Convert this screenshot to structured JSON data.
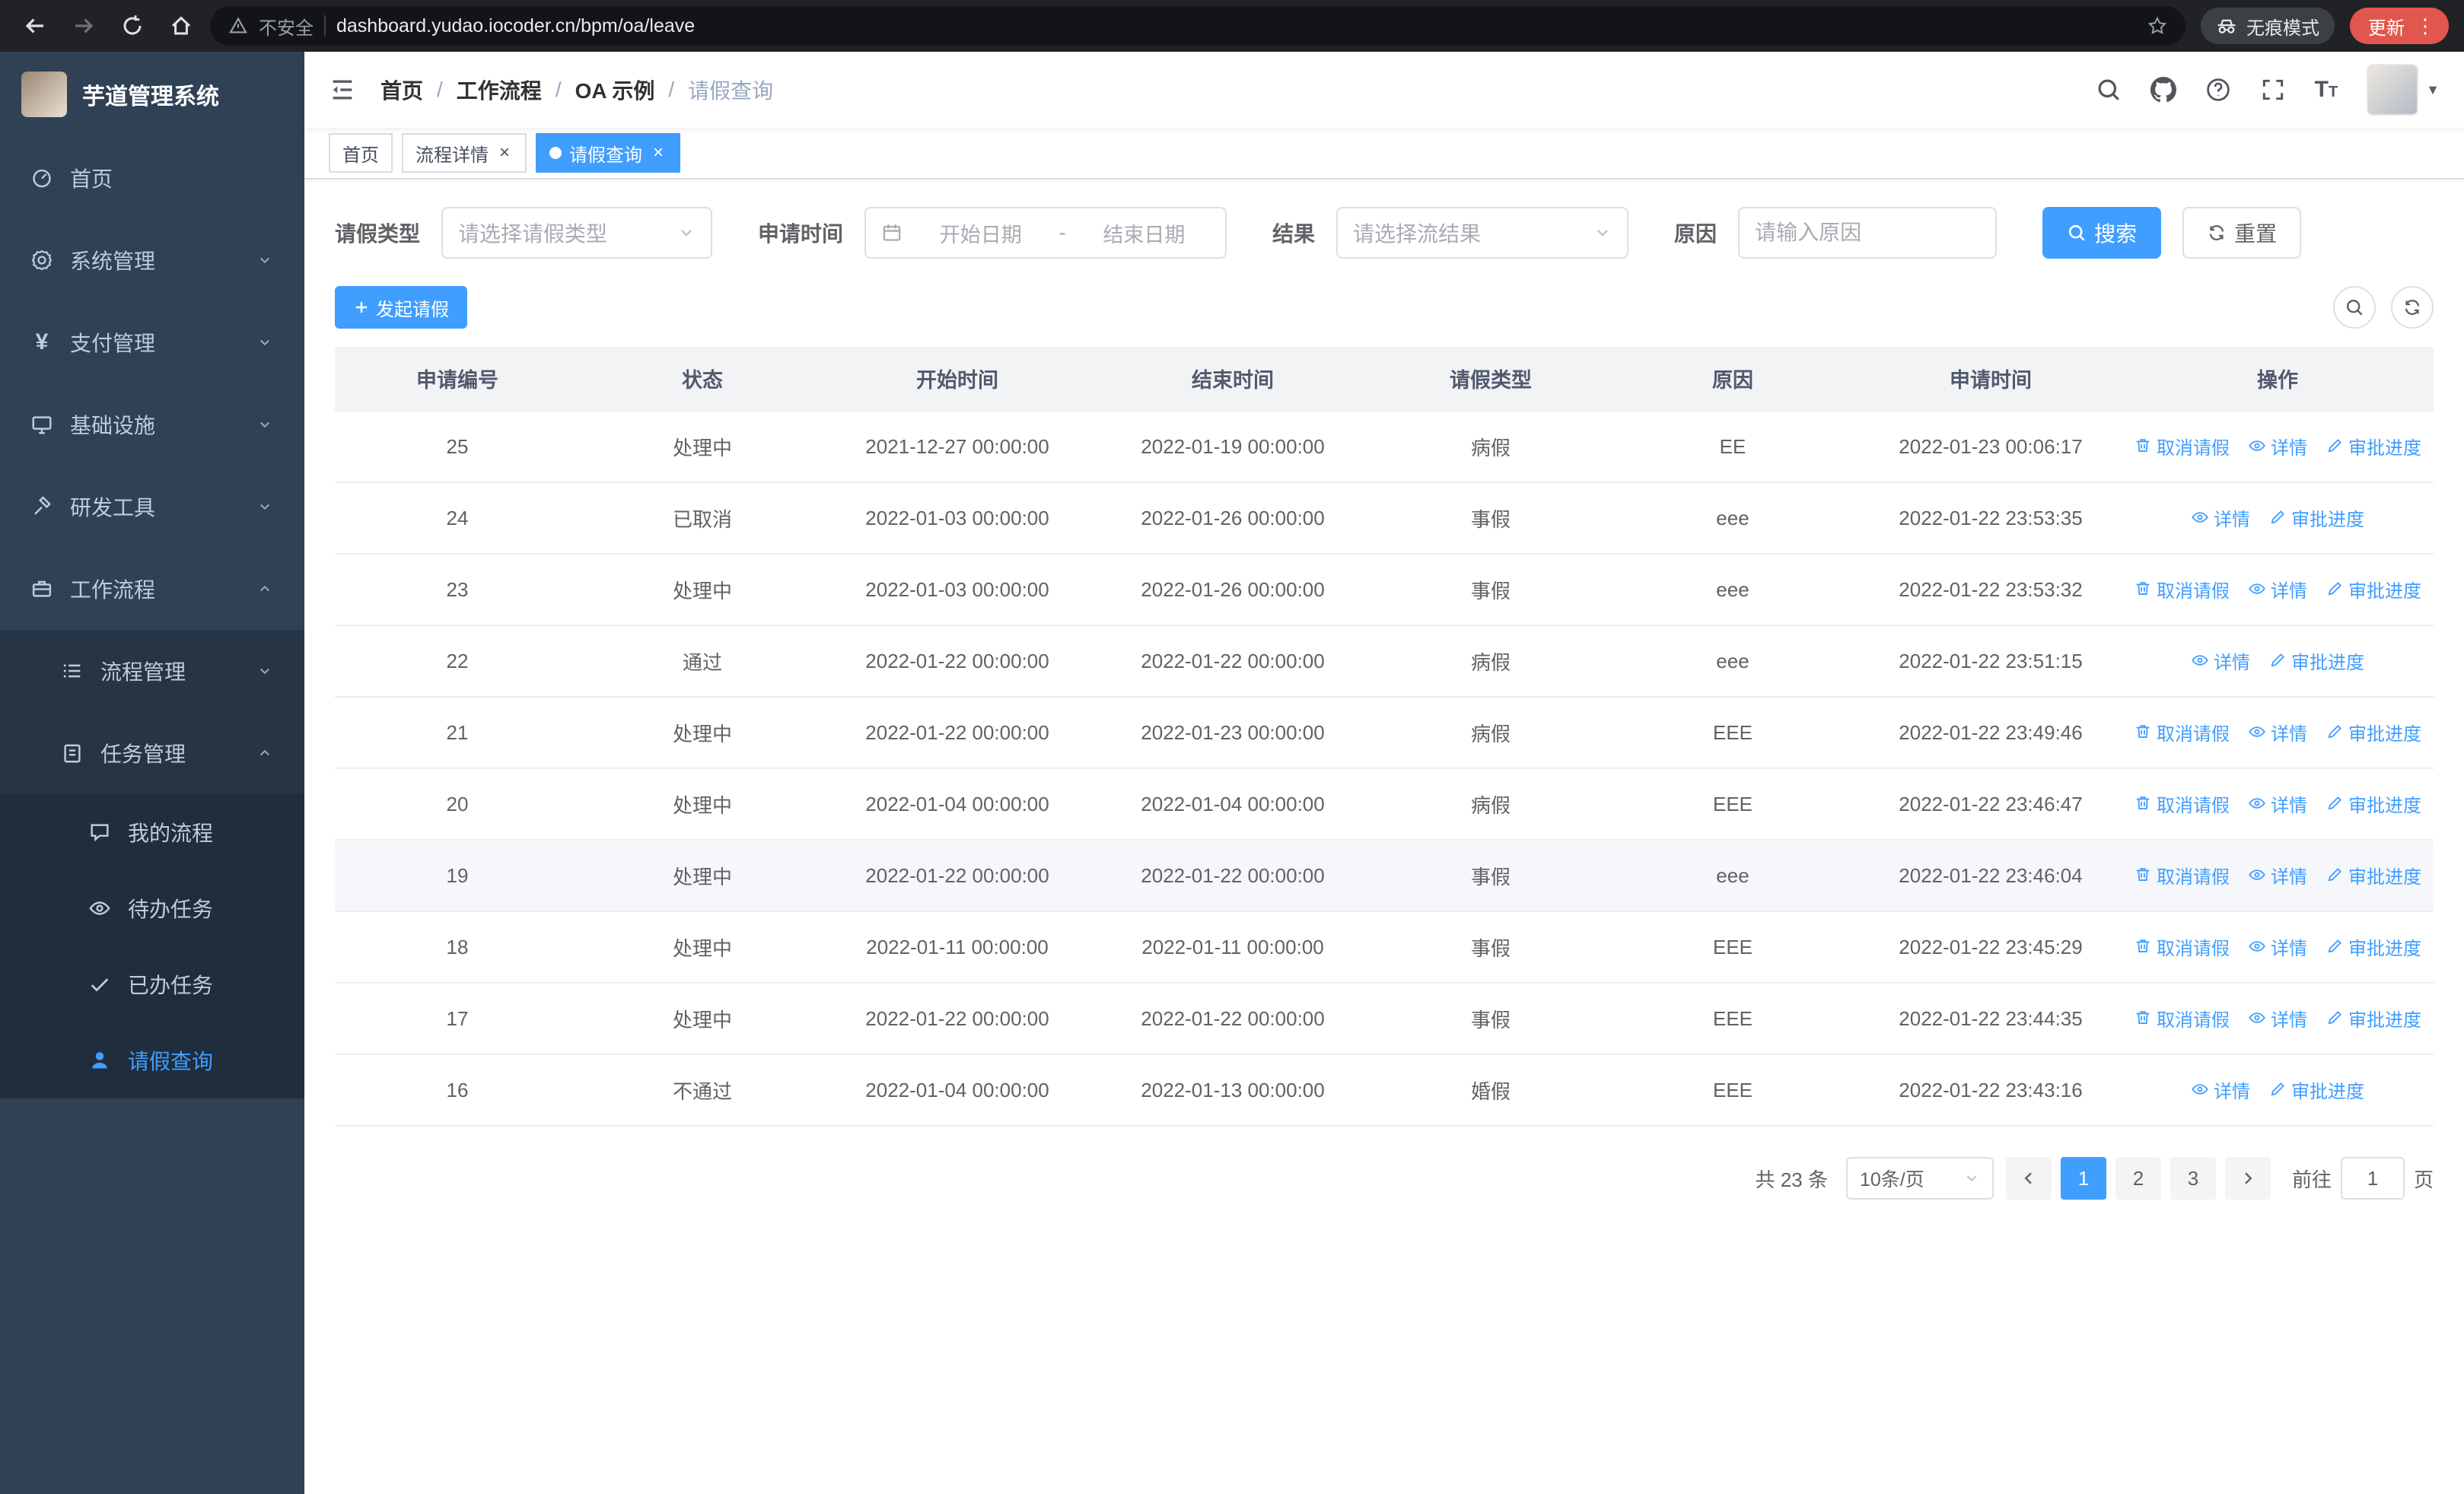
{
  "browser": {
    "security_label": "不安全",
    "url": "dashboard.yudao.iocoder.cn/bpm/oa/leave",
    "incognito_label": "无痕模式",
    "update_label": "更新"
  },
  "sidebar": {
    "title": "芋道管理系统",
    "items": [
      {
        "label": "首页"
      },
      {
        "label": "系统管理"
      },
      {
        "label": "支付管理"
      },
      {
        "label": "基础设施"
      },
      {
        "label": "研发工具"
      },
      {
        "label": "工作流程"
      }
    ],
    "workflow_children": [
      {
        "label": "流程管理"
      },
      {
        "label": "任务管理"
      }
    ],
    "task_children": [
      {
        "label": "我的流程"
      },
      {
        "label": "待办任务"
      },
      {
        "label": "已办任务"
      },
      {
        "label": "请假查询"
      }
    ]
  },
  "header": {
    "breadcrumb": [
      "首页",
      "工作流程",
      "OA 示例",
      "请假查询"
    ]
  },
  "tabs": [
    {
      "label": "首页"
    },
    {
      "label": "流程详情"
    },
    {
      "label": "请假查询"
    }
  ],
  "filters": {
    "leave_type_label": "请假类型",
    "leave_type_placeholder": "请选择请假类型",
    "apply_time_label": "申请时间",
    "start_placeholder": "开始日期",
    "range_separator": "-",
    "end_placeholder": "结束日期",
    "result_label": "结果",
    "result_placeholder": "请选择流结果",
    "reason_label": "原因",
    "reason_placeholder": "请输入原因",
    "search_label": "搜索",
    "reset_label": "重置"
  },
  "toolbar": {
    "create_label": "发起请假"
  },
  "table": {
    "headers": [
      "申请编号",
      "状态",
      "开始时间",
      "结束时间",
      "请假类型",
      "原因",
      "申请时间",
      "操作"
    ],
    "actions": {
      "cancel": {
        "label": "取消请假",
        "icon": "delete-icon"
      },
      "detail": {
        "label": "详情",
        "icon": "view-icon"
      },
      "progress": {
        "label": "审批进度",
        "icon": "edit-icon"
      }
    },
    "rows": [
      {
        "id": "25",
        "status": "处理中",
        "start": "2021-12-27 00:00:00",
        "end": "2022-01-19 00:00:00",
        "type": "病假",
        "reason": "EE",
        "apply_time": "2022-01-23 00:06:17",
        "actions": [
          "cancel",
          "detail",
          "progress"
        ]
      },
      {
        "id": "24",
        "status": "已取消",
        "start": "2022-01-03 00:00:00",
        "end": "2022-01-26 00:00:00",
        "type": "事假",
        "reason": "eee",
        "apply_time": "2022-01-22 23:53:35",
        "actions": [
          "detail",
          "progress"
        ]
      },
      {
        "id": "23",
        "status": "处理中",
        "start": "2022-01-03 00:00:00",
        "end": "2022-01-26 00:00:00",
        "type": "事假",
        "reason": "eee",
        "apply_time": "2022-01-22 23:53:32",
        "actions": [
          "cancel",
          "detail",
          "progress"
        ]
      },
      {
        "id": "22",
        "status": "通过",
        "start": "2022-01-22 00:00:00",
        "end": "2022-01-22 00:00:00",
        "type": "病假",
        "reason": "eee",
        "apply_time": "2022-01-22 23:51:15",
        "actions": [
          "detail",
          "progress"
        ]
      },
      {
        "id": "21",
        "status": "处理中",
        "start": "2022-01-22 00:00:00",
        "end": "2022-01-23 00:00:00",
        "type": "病假",
        "reason": "EEE",
        "apply_time": "2022-01-22 23:49:46",
        "actions": [
          "cancel",
          "detail",
          "progress"
        ]
      },
      {
        "id": "20",
        "status": "处理中",
        "start": "2022-01-04 00:00:00",
        "end": "2022-01-04 00:00:00",
        "type": "病假",
        "reason": "EEE",
        "apply_time": "2022-01-22 23:46:47",
        "actions": [
          "cancel",
          "detail",
          "progress"
        ]
      },
      {
        "id": "19",
        "status": "处理中",
        "start": "2022-01-22 00:00:00",
        "end": "2022-01-22 00:00:00",
        "type": "事假",
        "reason": "eee",
        "apply_time": "2022-01-22 23:46:04",
        "actions": [
          "cancel",
          "detail",
          "progress"
        ],
        "highlighted": true
      },
      {
        "id": "18",
        "status": "处理中",
        "start": "2022-01-11 00:00:00",
        "end": "2022-01-11 00:00:00",
        "type": "事假",
        "reason": "EEE",
        "apply_time": "2022-01-22 23:45:29",
        "actions": [
          "cancel",
          "detail",
          "progress"
        ]
      },
      {
        "id": "17",
        "status": "处理中",
        "start": "2022-01-22 00:00:00",
        "end": "2022-01-22 00:00:00",
        "type": "事假",
        "reason": "EEE",
        "apply_time": "2022-01-22 23:44:35",
        "actions": [
          "cancel",
          "detail",
          "progress"
        ]
      },
      {
        "id": "16",
        "status": "不通过",
        "start": "2022-01-04 00:00:00",
        "end": "2022-01-13 00:00:00",
        "type": "婚假",
        "reason": "EEE",
        "apply_time": "2022-01-22 23:43:16",
        "actions": [
          "detail",
          "progress"
        ]
      }
    ]
  },
  "pagination": {
    "total": "共 23 条",
    "page_size": "10条/页",
    "pages": [
      "1",
      "2",
      "3"
    ],
    "active_page": "1",
    "goto_label": "前往",
    "goto_value": "1",
    "goto_suffix": "页"
  },
  "colors": {
    "primary": "#409eff",
    "sidebar_bg": "#304156",
    "update_pill": "#e2574d"
  }
}
